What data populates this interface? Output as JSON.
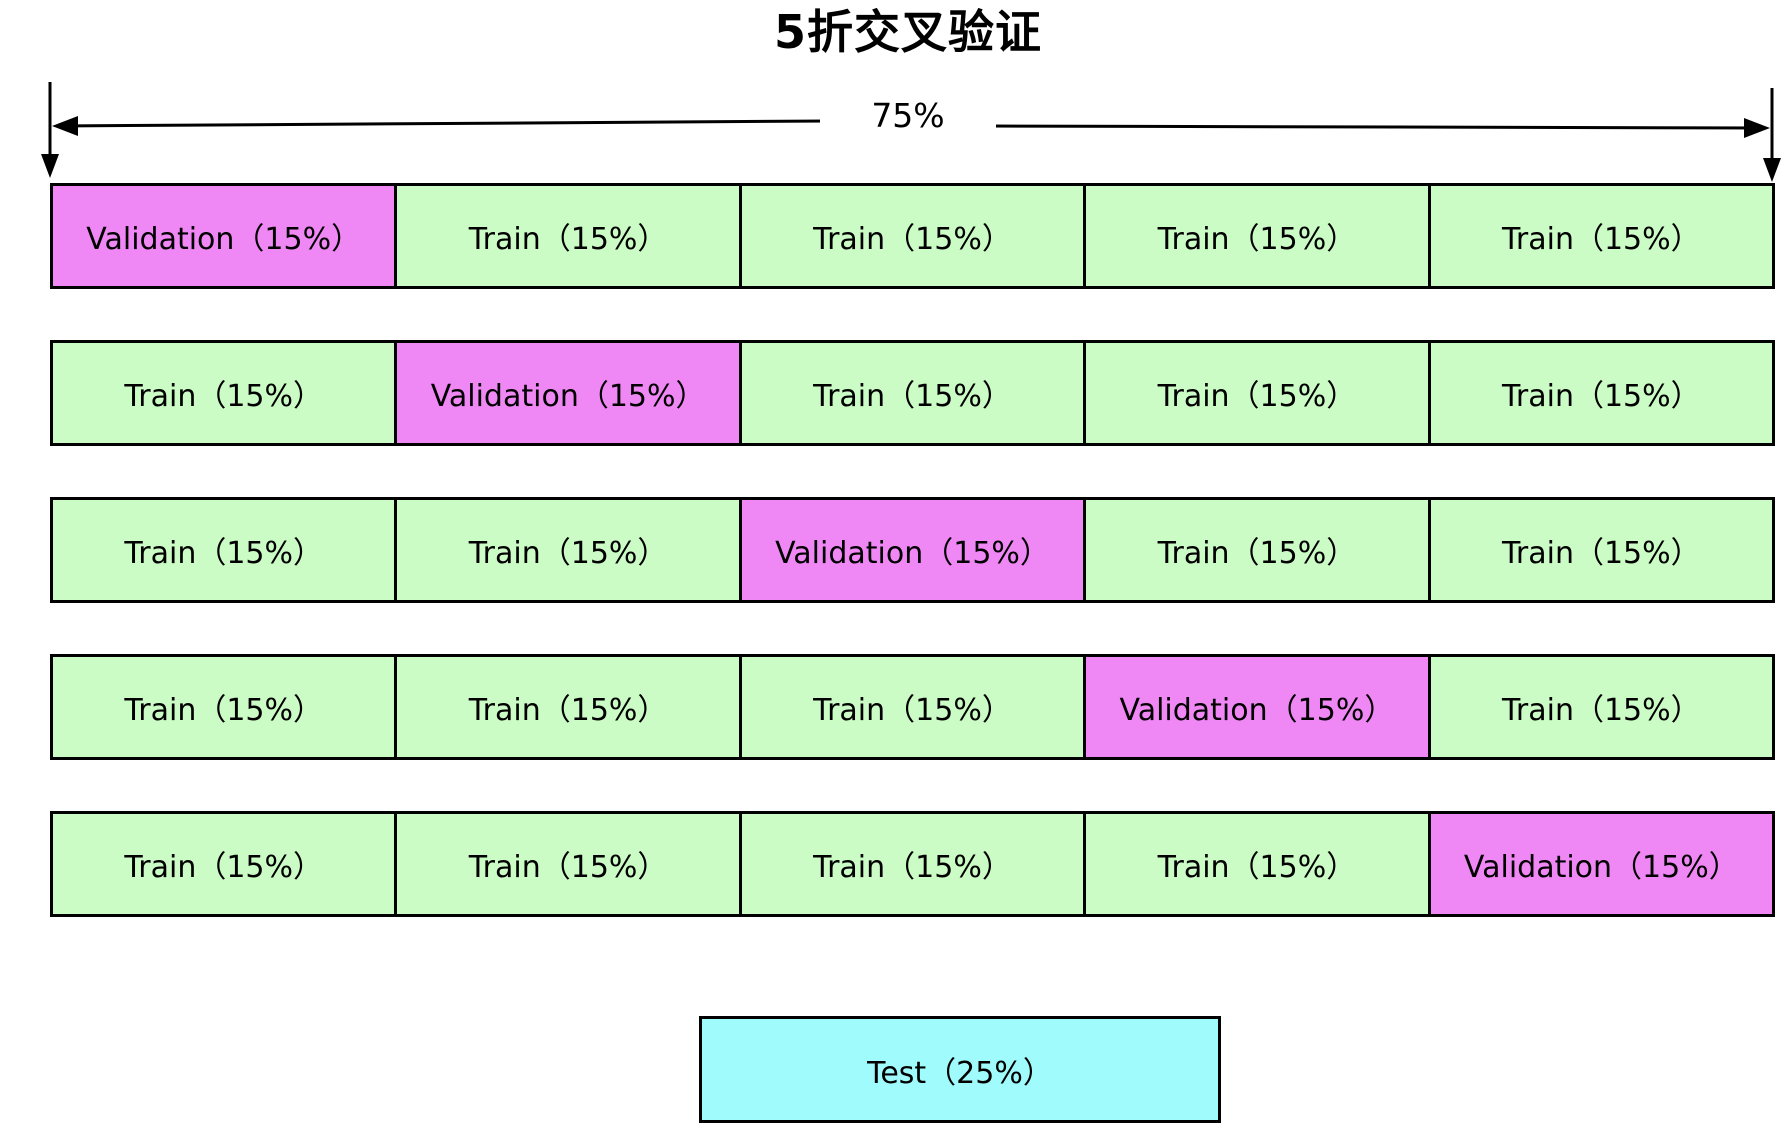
{
  "title": "5折交叉验证",
  "span_label": "75%",
  "colors": {
    "train": "#ccfcc5",
    "validation": "#ef88f4",
    "test": "#a0fcfc",
    "border": "#000000"
  },
  "folds": [
    {
      "cells": [
        {
          "label": "Validation（15%）",
          "kind": "validation"
        },
        {
          "label": "Train（15%）",
          "kind": "train"
        },
        {
          "label": "Train（15%）",
          "kind": "train"
        },
        {
          "label": "Train（15%）",
          "kind": "train"
        },
        {
          "label": "Train（15%）",
          "kind": "train"
        }
      ]
    },
    {
      "cells": [
        {
          "label": "Train（15%）",
          "kind": "train"
        },
        {
          "label": "Validation（15%）",
          "kind": "validation"
        },
        {
          "label": "Train（15%）",
          "kind": "train"
        },
        {
          "label": "Train（15%）",
          "kind": "train"
        },
        {
          "label": "Train（15%）",
          "kind": "train"
        }
      ]
    },
    {
      "cells": [
        {
          "label": "Train（15%）",
          "kind": "train"
        },
        {
          "label": "Train（15%）",
          "kind": "train"
        },
        {
          "label": "Validation（15%）",
          "kind": "validation"
        },
        {
          "label": "Train（15%）",
          "kind": "train"
        },
        {
          "label": "Train（15%）",
          "kind": "train"
        }
      ]
    },
    {
      "cells": [
        {
          "label": "Train（15%）",
          "kind": "train"
        },
        {
          "label": "Train（15%）",
          "kind": "train"
        },
        {
          "label": "Train（15%）",
          "kind": "train"
        },
        {
          "label": "Validation（15%）",
          "kind": "validation"
        },
        {
          "label": "Train（15%）",
          "kind": "train"
        }
      ]
    },
    {
      "cells": [
        {
          "label": "Train（15%）",
          "kind": "train"
        },
        {
          "label": "Train（15%）",
          "kind": "train"
        },
        {
          "label": "Train（15%）",
          "kind": "train"
        },
        {
          "label": "Train（15%）",
          "kind": "train"
        },
        {
          "label": "Validation（15%）",
          "kind": "validation"
        }
      ]
    }
  ],
  "test": {
    "label": "Test（25%）",
    "kind": "test"
  }
}
